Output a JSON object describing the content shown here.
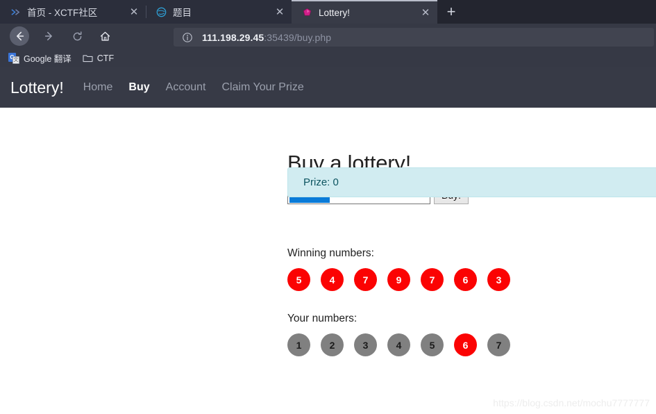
{
  "browser": {
    "tabs": [
      {
        "title": "首页 - XCTF社区",
        "favicon": "xctf-icon",
        "active": false,
        "close_label": "✕"
      },
      {
        "title": "题目",
        "favicon": "globe-icon",
        "active": false,
        "close_label": "✕"
      },
      {
        "title": "Lottery!",
        "favicon": "gem-icon",
        "active": true,
        "close_label": "✕"
      }
    ],
    "new_tab_label": "+",
    "toolbar": {
      "back_label": "←",
      "forward_label": "→",
      "reload_label": "⟳",
      "home_label": "⌂"
    },
    "url": {
      "host": "111.198.29.45",
      "path": ":35439/buy.php",
      "info_icon": "info-circle-icon"
    },
    "bookmarks": [
      {
        "label": "Google 翻译",
        "icon": "google-translate-icon",
        "badge": "G",
        "badge2": "文"
      },
      {
        "label": "CTF",
        "icon": "folder-icon"
      }
    ]
  },
  "page": {
    "navbar": {
      "brand": "Lottery!",
      "links": [
        {
          "label": "Home",
          "active": false
        },
        {
          "label": "Buy",
          "active": true
        },
        {
          "label": "Account",
          "active": false
        },
        {
          "label": "Claim Your Prize",
          "active": false
        }
      ]
    },
    "title": "Buy a lottery!",
    "form": {
      "value": "1234567",
      "placeholder": "",
      "submit_label": "Buy!"
    },
    "alert": {
      "text": "Prize: 0",
      "bg_color": "#d1ecf1",
      "text_color": "#0c5460"
    },
    "winning": {
      "label": "Winning numbers:",
      "numbers": [
        {
          "value": "5",
          "color": "red"
        },
        {
          "value": "4",
          "color": "red"
        },
        {
          "value": "7",
          "color": "red"
        },
        {
          "value": "9",
          "color": "red"
        },
        {
          "value": "7",
          "color": "red"
        },
        {
          "value": "6",
          "color": "red"
        },
        {
          "value": "3",
          "color": "red"
        }
      ]
    },
    "yours": {
      "label": "Your numbers:",
      "numbers": [
        {
          "value": "1",
          "color": "gray"
        },
        {
          "value": "2",
          "color": "gray"
        },
        {
          "value": "3",
          "color": "gray"
        },
        {
          "value": "4",
          "color": "gray"
        },
        {
          "value": "5",
          "color": "gray"
        },
        {
          "value": "6",
          "color": "red"
        },
        {
          "value": "7",
          "color": "gray"
        }
      ]
    },
    "watermark": "https://blog.csdn.net/mochu7777777"
  }
}
